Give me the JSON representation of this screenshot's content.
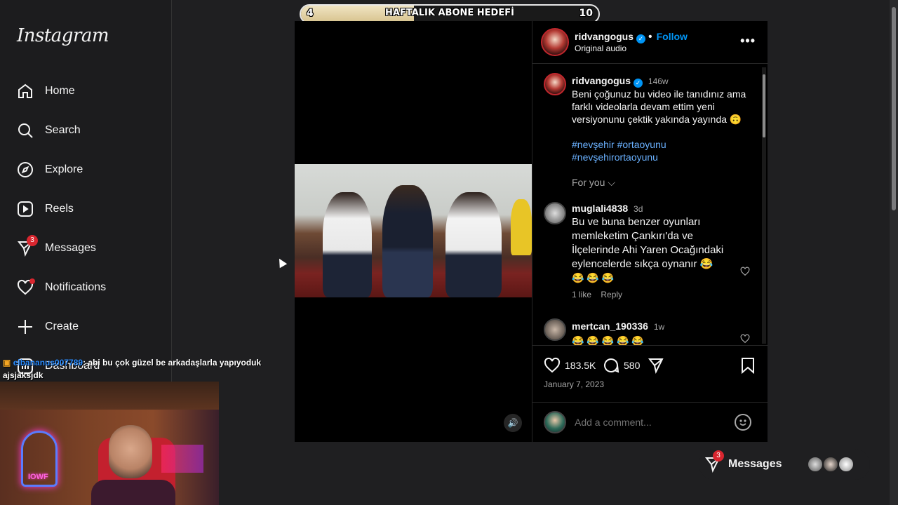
{
  "sidebar": {
    "logo": "Instagram",
    "items": [
      {
        "label": "Home",
        "icon": "home-icon"
      },
      {
        "label": "Search",
        "icon": "search-icon"
      },
      {
        "label": "Explore",
        "icon": "compass-icon"
      },
      {
        "label": "Reels",
        "icon": "reels-icon"
      },
      {
        "label": "Messages",
        "icon": "messenger-icon",
        "badge": "3"
      },
      {
        "label": "Notifications",
        "icon": "heart-icon"
      },
      {
        "label": "Create",
        "icon": "plus-icon"
      },
      {
        "label": "Dashboard",
        "icon": "dashboard-icon"
      }
    ]
  },
  "goal_banner": {
    "start": "4",
    "title": "HAFTALIK ABONE HEDEFİ",
    "end": "10",
    "progress_fraction": 0.38
  },
  "post": {
    "username": "ridvangogus",
    "follow_label": "Follow",
    "audio": "Original audio",
    "caption": {
      "username": "ridvangogus",
      "time": "146w",
      "text": "Beni çoğunuz bu video ile tanıdınız ama farklı videolarla devam ettim yeni versiyonunu çektik yakında yayında 🙃",
      "hashtags_line1": "#nevşehir #ortaoyunu",
      "hashtags_line2": "#nevşehirortaoyunu"
    },
    "for_you_label": "For you",
    "comments": [
      {
        "username": "muglali4838",
        "time": "3d",
        "text": "Bu ve buna benzer oyunları memleketim Çankırı'da ve İlçelerinde Ahi Yaren Ocağındaki eylencelerde sıkça oynanır 😂",
        "emoji_line": "😂 😂 😂",
        "likes": "1 like",
        "reply": "Reply"
      },
      {
        "username": "mertcan_190336",
        "time": "1w",
        "emoji_line": "😂 😂 😂 😂 😂"
      }
    ],
    "likes_count": "183.5K",
    "comments_count": "580",
    "date": "January 7, 2023",
    "add_comment_placeholder": "Add a comment..."
  },
  "messages_bar": {
    "label": "Messages",
    "badge": "3"
  },
  "stream_overlay": {
    "chat_user": "elbananus007789",
    "chat_text": ": abi bu çok güzel be arkadaşlarla yapıyoduk",
    "chat_text_line2": "ajsjaksjdk",
    "webcam_logo": "IOWF"
  },
  "colors": {
    "accent_blue": "#0095f6",
    "badge_red": "#d9262f",
    "background": "#1f1f21"
  }
}
